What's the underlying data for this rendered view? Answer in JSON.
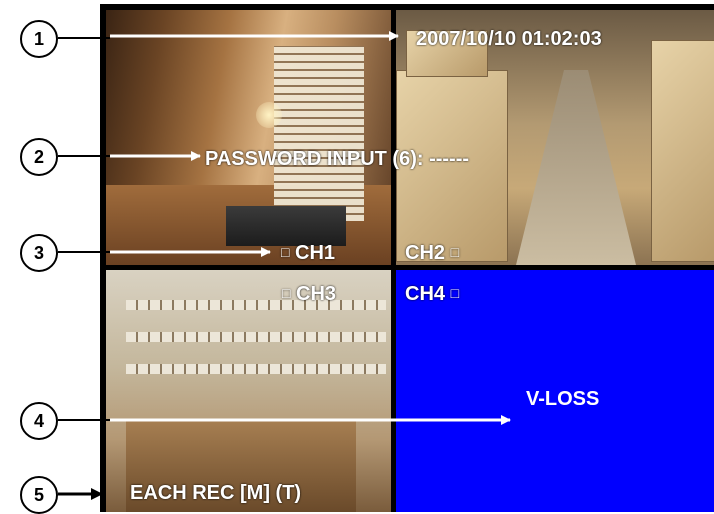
{
  "osd": {
    "datetime": "2007/10/10 01:02:03",
    "password_prompt": "PASSWORD INPUT (6): ------",
    "channels": {
      "ch1": "CH1",
      "ch2": "CH2",
      "ch3": "CH3",
      "ch4": "CH4",
      "indicator": "□"
    },
    "vloss": "V-LOSS",
    "record_mode": "EACH REC [M] (T)"
  },
  "callouts": [
    "1",
    "2",
    "3",
    "4",
    "5"
  ],
  "colors": {
    "vloss_background": "#0000ff",
    "osd_text": "#ffffff",
    "frame": "#000000"
  }
}
